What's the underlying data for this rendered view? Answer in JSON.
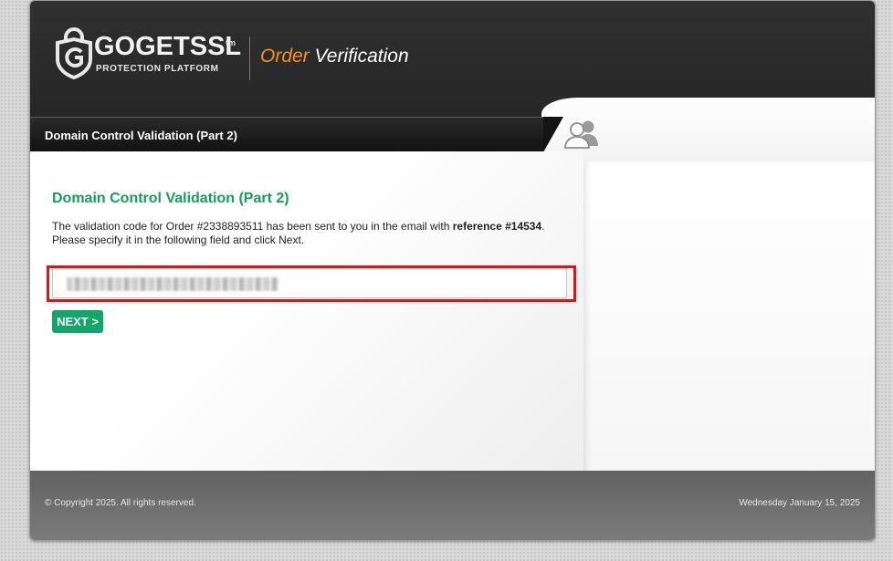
{
  "header": {
    "logo_word": "GOGETSSL",
    "logo_tm": "tm",
    "logo_tagline": "PROTECTION PLATFORM",
    "page_title_accent": "Order",
    "page_title_rest": "Verification",
    "logo_icon": "shield-lock-icon",
    "user_icon": "users-icon"
  },
  "title_bar": {
    "label": "Domain Control Validation (Part 2)"
  },
  "main": {
    "section_title": "Domain Control Validation (Part 2)",
    "message_prefix": "The validation code for Order #2338893511 has been sent to you in the email with ",
    "message_reference": "reference #14534",
    "message_suffix": ".",
    "instruction": "Please specify it in the following field and click Next.",
    "code_input_value": "",
    "next_label": "NEXT >"
  },
  "footer": {
    "copyright": "© Copyright 2025. All rights reserved.",
    "date": "Wednesday January 15, 2025"
  },
  "colors": {
    "accent_green": "#12a05a",
    "button_green": "#12a66a",
    "highlight_red": "#e11414",
    "logo_orange": "#f0931e",
    "header_dark": "#2b2b2b"
  }
}
